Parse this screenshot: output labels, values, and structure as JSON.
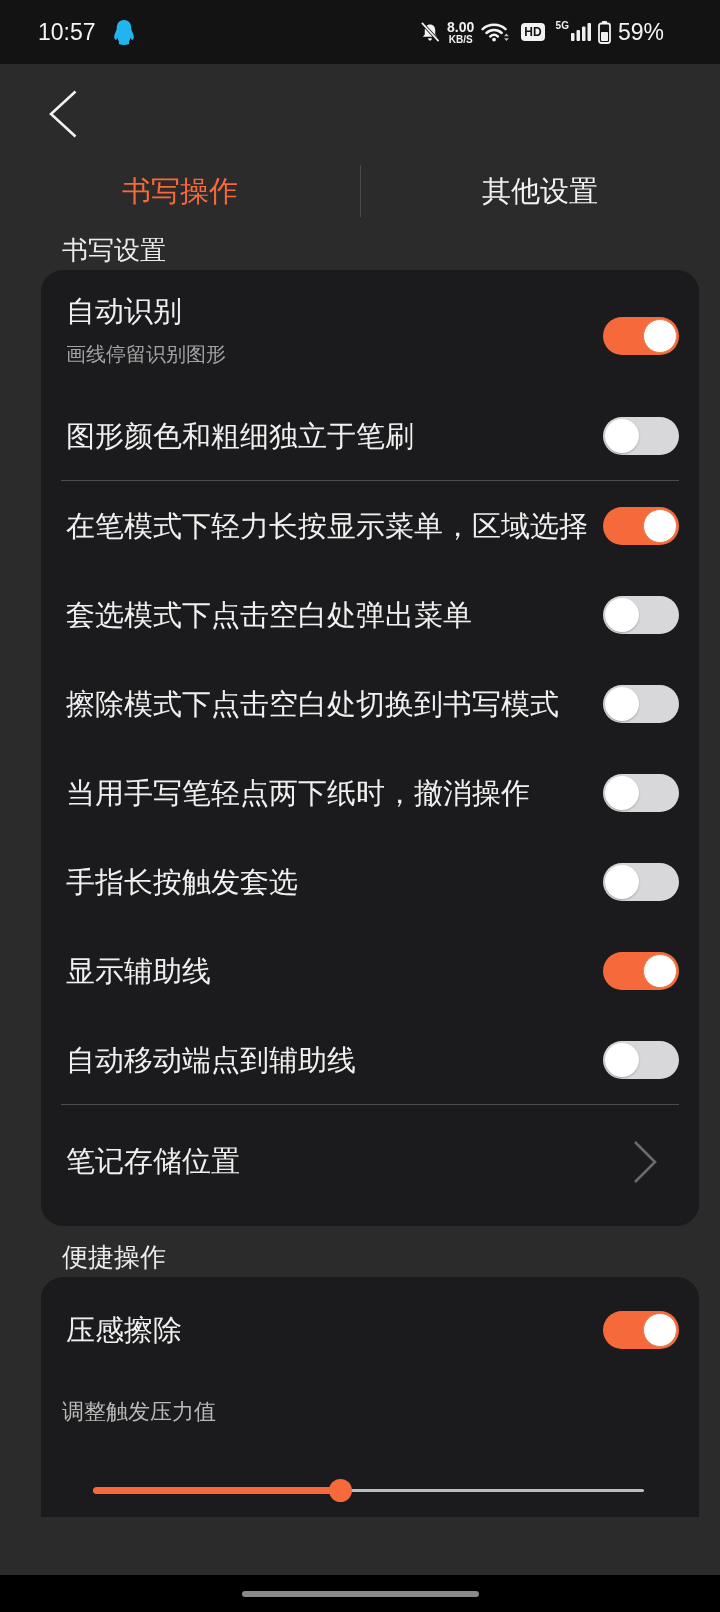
{
  "status_bar": {
    "time": "10:57",
    "speed_value": "8.00",
    "speed_unit": "KB/S",
    "hd_label": "HD",
    "network_type": "5G",
    "battery": "59%"
  },
  "tabs": [
    {
      "label": "书写操作",
      "selected": true
    },
    {
      "label": "其他设置",
      "selected": false
    }
  ],
  "sections": [
    {
      "title": "书写设置",
      "groups": [
        {
          "items": [
            {
              "kind": "toggle",
              "label": "自动识别",
              "description": "画线停留识别图形",
              "on": true
            },
            {
              "kind": "toggle",
              "label": "图形颜色和粗细独立于笔刷",
              "on": false
            }
          ]
        },
        {
          "items": [
            {
              "kind": "toggle",
              "label": "在笔模式下轻力长按显示菜单，区域选择",
              "on": true
            },
            {
              "kind": "toggle",
              "label": "套选模式下点击空白处弹出菜单",
              "on": false
            },
            {
              "kind": "toggle",
              "label": "擦除模式下点击空白处切换到书写模式",
              "on": false
            },
            {
              "kind": "toggle",
              "label": "当用手写笔轻点两下纸时，撤消操作",
              "on": false
            },
            {
              "kind": "toggle",
              "label": "手指长按触发套选",
              "on": false
            },
            {
              "kind": "toggle",
              "label": "显示辅助线",
              "on": true
            },
            {
              "kind": "toggle",
              "label": "自动移动端点到辅助线",
              "on": false
            }
          ]
        },
        {
          "items": [
            {
              "kind": "link",
              "label": "笔记存储位置"
            }
          ]
        }
      ]
    },
    {
      "title": "便捷操作",
      "groups": [
        {
          "items": [
            {
              "kind": "toggle",
              "label": "压感擦除",
              "on": true
            },
            {
              "kind": "slider",
              "label": "调整触发压力值",
              "level": 0.45
            }
          ]
        }
      ]
    }
  ]
}
